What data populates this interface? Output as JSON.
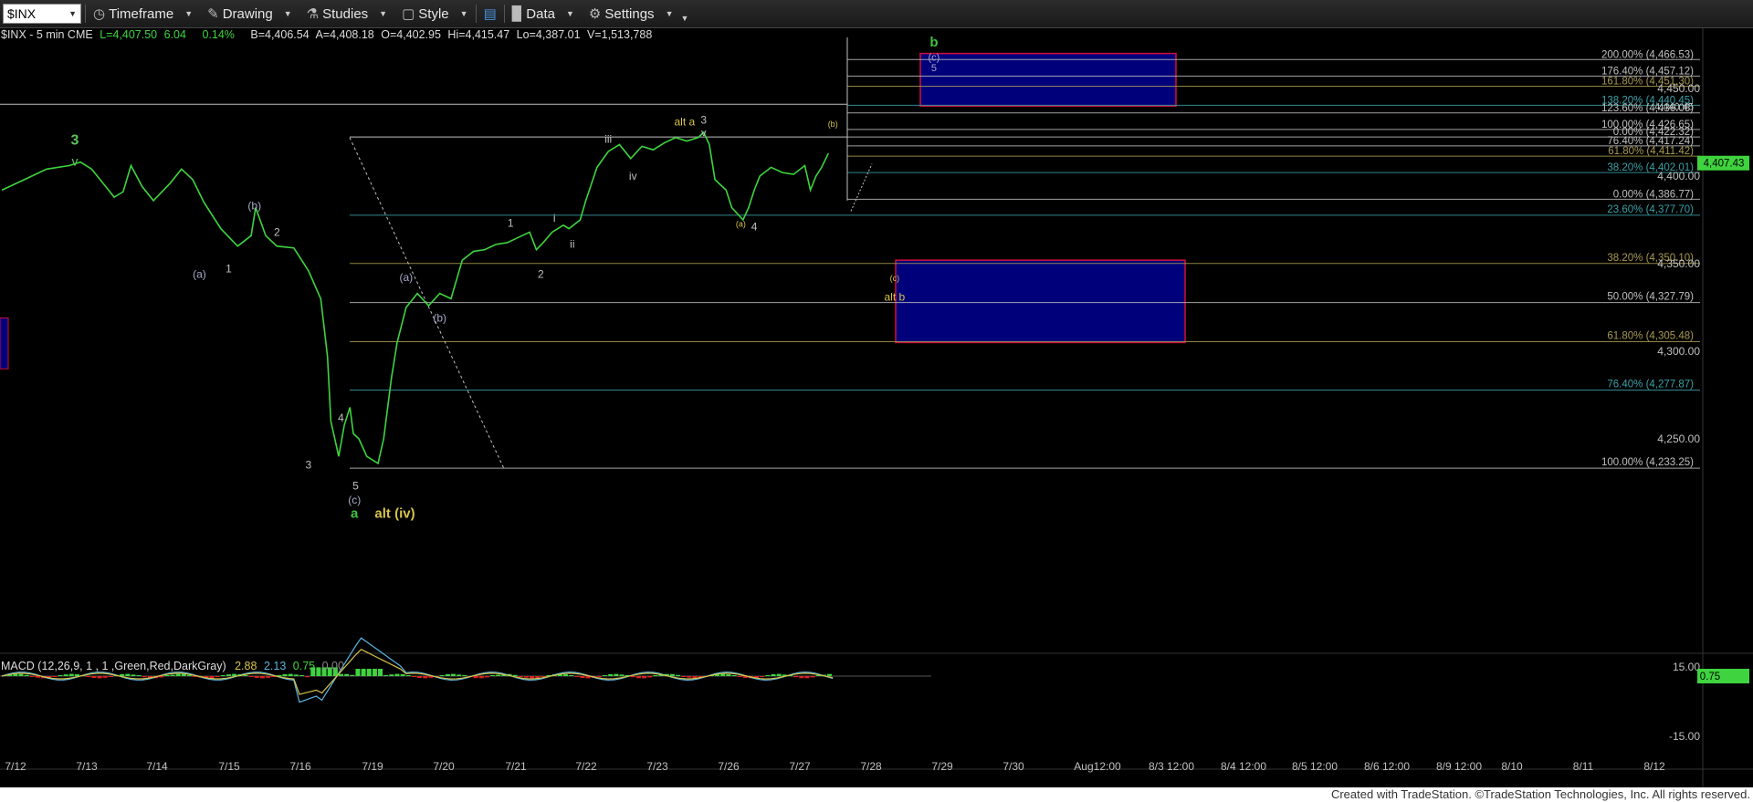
{
  "toolbar": {
    "symbol": "$INX",
    "timeframe": "Timeframe",
    "drawing": "Drawing",
    "studies": "Studies",
    "style": "Style",
    "data": "Data",
    "settings": "Settings"
  },
  "info": {
    "symbol": "$INX - 5 min  CME",
    "last": "L=4,407.50",
    "change": "6.04",
    "change_pct": "0.14%",
    "bid": "B=4,406.54",
    "ask": "A=4,408.18",
    "open": "O=4,402.95",
    "high": "Hi=4,415.47",
    "low": "Lo=4,387.01",
    "volume": "V=1,513,788"
  },
  "macd": {
    "label": "MACD (12,26,9, 1 , 1 ,Green,Red,DarkGray)",
    "v1": "2.88",
    "v2": "2.13",
    "v3": "0.75",
    "v4": "0.00",
    "axis_top": "15.00",
    "axis_bottom": "-15.00",
    "current": "0.75"
  },
  "price_axis": {
    "ticks": [
      {
        "label": "4,450.00",
        "value": 4450
      },
      {
        "label": "4,400.00",
        "value": 4400
      },
      {
        "label": "4,350.00",
        "value": 4350
      },
      {
        "label": "4,300.00",
        "value": 4300
      },
      {
        "label": "4,250.00",
        "value": 4250
      }
    ],
    "current": "4,407.43"
  },
  "date_axis": [
    "7/12",
    "7/13",
    "7/14",
    "7/15",
    "7/16",
    "7/19",
    "7/20",
    "7/21",
    "7/22",
    "7/23",
    "7/26",
    "7/27",
    "7/28",
    "7/29",
    "7/30",
    "Aug12:00",
    "8/3 12:00",
    "8/4 12:00",
    "8/5 12:00",
    "8/6 12:00",
    "8/9 12:00",
    "8/10",
    "8/11",
    "8/12"
  ],
  "fibs_upper": [
    {
      "label": "200.00% (4,466.53)",
      "price": 4466.53,
      "color": "#c0c0c0"
    },
    {
      "label": "176.40% (4,457.12)",
      "price": 4457.12,
      "color": "#c0c0c0"
    },
    {
      "label": "161.80% (4,451.30)",
      "price": 4451.3,
      "color": "#a89a50"
    },
    {
      "label": "138.20% (4,440.45)",
      "price": 4440.45,
      "color": "#3aa0a8"
    },
    {
      "label": "123.60% (4,436.06)",
      "price": 4436.06,
      "color": "#c0c0c0"
    },
    {
      "label": "100.00% (4,426.65)",
      "price": 4426.65,
      "color": "#c0c0c0"
    },
    {
      "label": "0.00% (4,422.32)",
      "price": 4422.32,
      "color": "#c0c0c0"
    },
    {
      "label": "76.40% (4,417.24)",
      "price": 4417.24,
      "color": "#c0c0c0"
    },
    {
      "label": "61.80% (4,411.42)",
      "price": 4411.42,
      "color": "#a89a50"
    },
    {
      "label": "38.20% (4,402.01)",
      "price": 4402.01,
      "color": "#3aa0a8"
    },
    {
      "label": "0.00% (4,386.77)",
      "price": 4386.77,
      "color": "#c0c0c0"
    }
  ],
  "fibs_lower": [
    {
      "label": "23.60% (4,377.70)",
      "price": 4377.7,
      "color": "#3aa0a8"
    },
    {
      "label": "38.20% (4,350.10)",
      "price": 4350.1,
      "color": "#a89a50"
    },
    {
      "label": "50.00% (4,327.79)",
      "price": 4327.79,
      "color": "#c0c0c0"
    },
    {
      "label": "61.80% (4,305.48)",
      "price": 4305.48,
      "color": "#a89a50"
    },
    {
      "label": "76.40% (4,277.87)",
      "price": 4277.87,
      "color": "#3aa0a8"
    },
    {
      "label": "100.00% (4,233.25)",
      "price": 4233.25,
      "color": "#c0c0c0"
    }
  ],
  "overlap_label": "4,440.45",
  "wave_labels": [
    {
      "text": "3",
      "color": "#5ec35e",
      "size": 16,
      "t": 6.5,
      "price": 4418
    },
    {
      "text": "v",
      "color": "#5ec35e",
      "size": 14,
      "t": 6.5,
      "price": 4406
    },
    {
      "text": "(b)",
      "color": "#a8a8c8",
      "size": 12,
      "t": 22.5,
      "price": 4381
    },
    {
      "text": "(a)",
      "color": "#a8a8c8",
      "size": 12,
      "t": 17.6,
      "price": 4342
    },
    {
      "text": "1",
      "color": "#c0c0c0",
      "size": 12,
      "t": 20.2,
      "price": 4345
    },
    {
      "text": "2",
      "color": "#c0c0c0",
      "size": 12,
      "t": 24.5,
      "price": 4366
    },
    {
      "text": "3",
      "color": "#c0c0c0",
      "size": 12,
      "t": 27.3,
      "price": 4233
    },
    {
      "text": "4",
      "color": "#c0c0c0",
      "size": 12,
      "t": 30.2,
      "price": 4260
    },
    {
      "text": "5",
      "color": "#c0c0c0",
      "size": 12,
      "t": 31.5,
      "price": 4221
    },
    {
      "text": "(c)",
      "color": "#a8a8c8",
      "size": 12,
      "t": 31.4,
      "price": 4213
    },
    {
      "text": "a",
      "color": "#3fc23f",
      "size": 15,
      "t": 31.4,
      "price": 4205
    },
    {
      "text": "alt (iv)",
      "color": "#d8c34a",
      "size": 15,
      "t": 35.0,
      "price": 4205
    },
    {
      "text": "(a)",
      "color": "#a8a8c8",
      "size": 12,
      "t": 36.0,
      "price": 4340
    },
    {
      "text": "(b)",
      "color": "#a8a8c8",
      "size": 12,
      "t": 39.0,
      "price": 4317
    },
    {
      "text": "1",
      "color": "#c0c0c0",
      "size": 12,
      "t": 45.3,
      "price": 4371
    },
    {
      "text": "2",
      "color": "#c0c0c0",
      "size": 12,
      "t": 48.0,
      "price": 4342
    },
    {
      "text": "i",
      "color": "#c0c0c0",
      "size": 12,
      "t": 49.2,
      "price": 4374
    },
    {
      "text": "ii",
      "color": "#c0c0c0",
      "size": 12,
      "t": 50.8,
      "price": 4359
    },
    {
      "text": "iii",
      "color": "#c0c0c0",
      "size": 12,
      "t": 54.0,
      "price": 4419
    },
    {
      "text": "iv",
      "color": "#c0c0c0",
      "size": 12,
      "t": 56.2,
      "price": 4398
    },
    {
      "text": "alt a",
      "color": "#d8c34a",
      "size": 12,
      "t": 60.8,
      "price": 4429
    },
    {
      "text": "3",
      "color": "#c0c0c0",
      "size": 12,
      "t": 62.5,
      "price": 4430
    },
    {
      "text": "v",
      "color": "#c0c0c0",
      "size": 11,
      "t": 62.5,
      "price": 4423
    },
    {
      "text": "(a)",
      "color": "#d8c34a",
      "size": 9,
      "t": 65.8,
      "price": 4371
    },
    {
      "text": "4",
      "color": "#c0c0c0",
      "size": 12,
      "t": 67.0,
      "price": 4369
    },
    {
      "text": "(b)",
      "color": "#d8c34a",
      "size": 9,
      "t": 74.0,
      "price": 4428
    },
    {
      "text": "b",
      "color": "#3fc23f",
      "size": 15,
      "t": 83.0,
      "price": 4474
    },
    {
      "text": "(c)",
      "color": "#a8a8c8",
      "size": 11,
      "t": 83.0,
      "price": 4466
    },
    {
      "text": "5",
      "color": "#a8a8c8",
      "size": 11,
      "t": 83.0,
      "price": 4460
    },
    {
      "text": "(c)",
      "color": "#d8c34a",
      "size": 9,
      "t": 79.5,
      "price": 4340
    },
    {
      "text": "alt b",
      "color": "#d8c34a",
      "size": 12,
      "t": 79.5,
      "price": 4329
    }
  ],
  "price_series": [
    [
      0,
      4392
    ],
    [
      2,
      4398
    ],
    [
      4,
      4404
    ],
    [
      6,
      4406
    ],
    [
      7,
      4408
    ],
    [
      8,
      4404
    ],
    [
      9,
      4396
    ],
    [
      10,
      4388
    ],
    [
      10.8,
      4391
    ],
    [
      11.5,
      4406
    ],
    [
      12.5,
      4394
    ],
    [
      13.5,
      4386
    ],
    [
      15,
      4396
    ],
    [
      16,
      4404
    ],
    [
      17,
      4398
    ],
    [
      18,
      4385
    ],
    [
      19.5,
      4370
    ],
    [
      21,
      4360
    ],
    [
      22.2,
      4366
    ],
    [
      22.6,
      4382
    ],
    [
      23.5,
      4366
    ],
    [
      24.5,
      4360
    ],
    [
      26,
      4359
    ],
    [
      27.3,
      4346
    ],
    [
      28.4,
      4330
    ],
    [
      29,
      4297
    ],
    [
      29.3,
      4260
    ],
    [
      30,
      4240
    ],
    [
      30.5,
      4258
    ],
    [
      31,
      4268
    ],
    [
      31.3,
      4253
    ],
    [
      31.8,
      4250
    ],
    [
      32.5,
      4240
    ],
    [
      33.5,
      4236
    ],
    [
      34,
      4250
    ],
    [
      34.7,
      4285
    ],
    [
      35.2,
      4305
    ],
    [
      36,
      4325
    ],
    [
      37,
      4333
    ],
    [
      38,
      4326
    ],
    [
      39,
      4333
    ],
    [
      40,
      4330
    ],
    [
      41,
      4352
    ],
    [
      42,
      4357
    ],
    [
      43,
      4358
    ],
    [
      44,
      4361
    ],
    [
      45,
      4362
    ],
    [
      46,
      4365
    ],
    [
      47,
      4368
    ],
    [
      47.6,
      4358
    ],
    [
      48.2,
      4362
    ],
    [
      49,
      4368
    ],
    [
      50,
      4372
    ],
    [
      50.5,
      4370
    ],
    [
      51.5,
      4375
    ],
    [
      52,
      4386
    ],
    [
      53,
      4405
    ],
    [
      54,
      4414
    ],
    [
      55,
      4418
    ],
    [
      56,
      4410
    ],
    [
      57,
      4417
    ],
    [
      58,
      4415
    ],
    [
      59,
      4419
    ],
    [
      60,
      4422
    ],
    [
      61,
      4420
    ],
    [
      62,
      4422
    ],
    [
      62.5,
      4425
    ],
    [
      63,
      4418
    ],
    [
      63.5,
      4398
    ],
    [
      64.5,
      4392
    ],
    [
      65,
      4382
    ],
    [
      66,
      4375
    ],
    [
      66.5,
      4382
    ],
    [
      67,
      4392
    ],
    [
      67.5,
      4400
    ],
    [
      68.5,
      4405
    ],
    [
      69.5,
      4402
    ],
    [
      70.5,
      4401
    ],
    [
      71.5,
      4406
    ],
    [
      72,
      4392
    ],
    [
      72.5,
      4400
    ],
    [
      73,
      4405
    ],
    [
      73.6,
      4413
    ]
  ]
}
